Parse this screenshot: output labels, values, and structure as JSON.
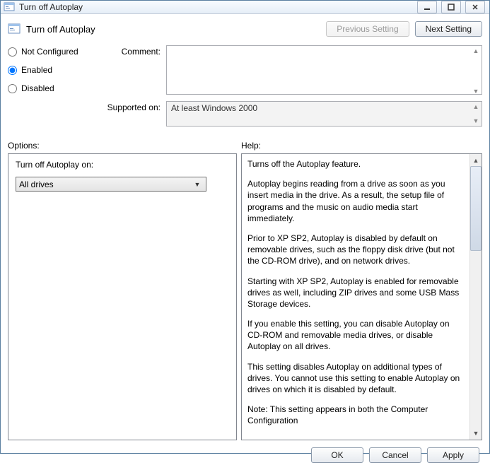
{
  "window": {
    "title": "Turn off Autoplay"
  },
  "header": {
    "title": "Turn off Autoplay",
    "prev_label": "Previous Setting",
    "next_label": "Next Setting"
  },
  "radios": {
    "not_configured": "Not Configured",
    "enabled": "Enabled",
    "disabled": "Disabled",
    "selected": "enabled"
  },
  "fields": {
    "comment_label": "Comment:",
    "comment_value": "",
    "supported_label": "Supported on:",
    "supported_value": "At least Windows 2000"
  },
  "section_labels": {
    "options": "Options:",
    "help": "Help:"
  },
  "options": {
    "setting_label": "Turn off Autoplay on:",
    "selected_value": "All drives"
  },
  "help": {
    "p1": "Turns off the Autoplay feature.",
    "p2": "Autoplay begins reading from a drive as soon as you insert media in the drive. As a result, the setup file of programs and the music on audio media start immediately.",
    "p3": "Prior to XP SP2, Autoplay is disabled by default on removable drives, such as the floppy disk drive (but not the CD-ROM drive), and on network drives.",
    "p4": "Starting with XP SP2, Autoplay is enabled for removable drives as well, including ZIP drives and some USB Mass Storage devices.",
    "p5": "If you enable this setting, you can disable Autoplay on CD-ROM and removable media drives, or disable Autoplay on all drives.",
    "p6": "This setting disables Autoplay on additional types of drives. You cannot use this setting to enable Autoplay on drives on which it is disabled by default.",
    "p7": "Note: This setting appears in both the Computer Configuration"
  },
  "footer": {
    "ok": "OK",
    "cancel": "Cancel",
    "apply": "Apply"
  }
}
